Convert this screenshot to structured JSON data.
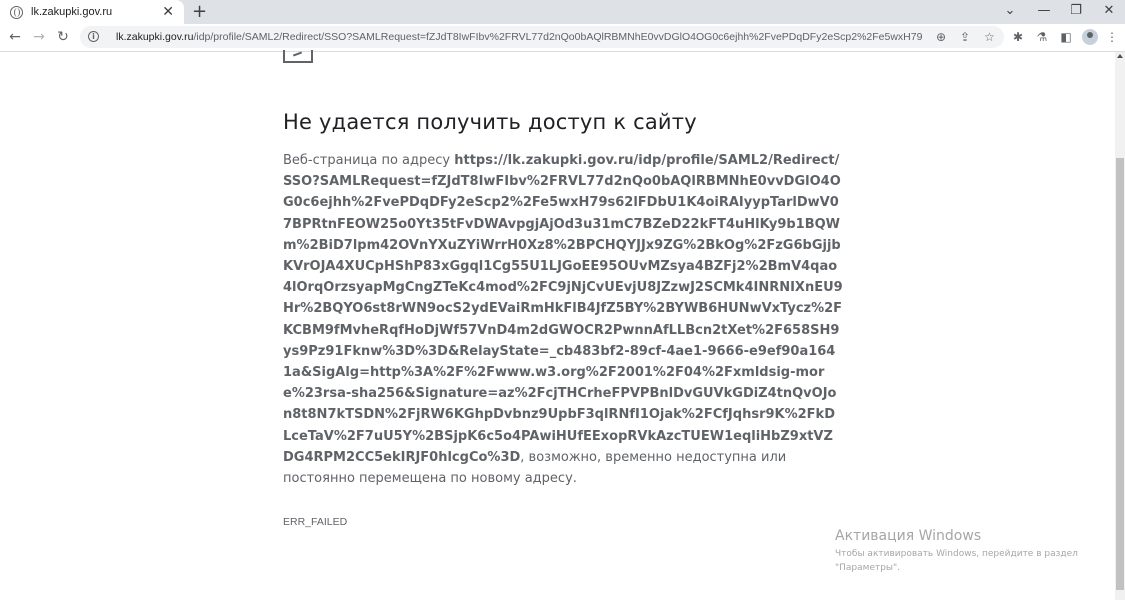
{
  "browser": {
    "tab": {
      "title": "lk.zakupki.gov.ru",
      "close": "✕"
    },
    "new_tab": "+",
    "window_controls": {
      "tab_search": "⌄",
      "minimize": "—",
      "maximize": "❐",
      "close": "✕"
    },
    "nav": {
      "back": "←",
      "forward": "→",
      "reload": "↻"
    },
    "address": {
      "host": "lk.zakupki.gov.ru",
      "path": "/idp/profile/SAML2/Redirect/SSO?SAMLRequest=fZJdT8IwFIbv%2FRVL77d2nQo0bAQlRBMNhE0vvDGlO4OG0c6ejhh%2FvePDqDFy2eScp2%2Fe5wxH79s62lFDbU1...",
      "info_icon": "i"
    },
    "omnibox_icons": {
      "zoom": "⊕",
      "share": "⇪",
      "bookmark": "☆"
    },
    "toolbar_icons": {
      "extensions": "✱",
      "lab": "⚗",
      "sidepanel": "◧",
      "menu": "⋮"
    }
  },
  "page": {
    "title": "Не удается получить доступ к сайту",
    "body_prefix": "Веб-страница по адресу ",
    "url": "https://lk.zakupki.gov.ru/idp/profile/SAML2/Redirect/SSO?SAMLRequest=fZJdT8IwFIbv%2FRVL77d2nQo0bAQlRBMNhE0vvDGlO4OG0c6ejhh%2FvePDqDFy2eScp2%2Fe5wxH79s62lFDbU1K4oiRAIyypTarlDwV07BPRtnFEOW25o0Yt35tFvDWAvpgjAjOd3u31mC7BZeD22kFT4uHlKy9b1BQWm%2BiD7lpm42OVnYXuZYiWrrH0Xz8%2BPCHQYJJx9ZG%2BkOg%2FzG6bGjjbKVrOJA4XUCpHShP83xGgql1Cg55U1LJGoEE95OUvMZsya4BZFj2%2BmV4qao4lOrqOrzsyapMgCngZTeKc4mod%2FC9jNjCvUEvjU8JZzwJ2SCMk4INRNIXnEU9Hr%2BQYO6st8rWN9ocS2ydEVaiRmHkFlB4JfZ5BY%2BYWB6HUNwVxTycz%2FKCBM9fMvheRqfHoDjWf57VnD4m2dGWOCR2PwnnAfLLBcn2tXet%2F658SH9ys9Pz91Fknw%3D%3D&RelayState=_cb483bf2-89cf-4ae1-9666-e9ef90a1641a&SigAlg=http%3A%2F%2Fwww.w3.org%2F2001%2F04%2Fxmldsig-more%23rsa-sha256&Signature=az%2FcjTHCrheFPVPBnlDvGUVkGDiZ4tnQvOJon8t8N7kTSDN%2FjRW6KGhpDvbnz9UpbF3qlRNfI1Ojak%2FCfJqhsr9K%2FkDLceTaV%2F7uU5Y%2BSjpK6c5o4PAwiHUfEExopRVkAzcTUEW1eqliHbZ9xtVZDG4RPM2CC5ekIRJF0hlcgCo%3D",
    "body_suffix": ", возможно, временно недоступна или постоянно перемещена по новому адресу.",
    "error_code": "ERR_FAILED"
  },
  "watermark": {
    "title": "Активация Windows",
    "subtitle": "Чтобы активировать Windows, перейдите в раздел \"Параметры\"."
  }
}
